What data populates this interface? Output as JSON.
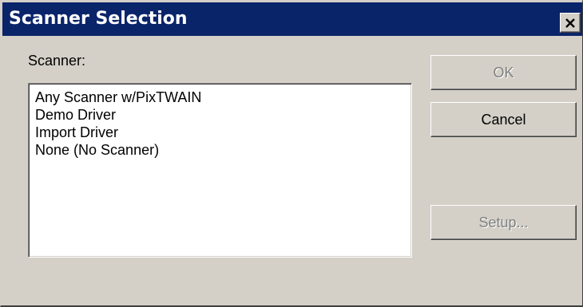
{
  "window": {
    "title": "Scanner Selection",
    "close_icon": "close-icon"
  },
  "scanner": {
    "label": "Scanner:",
    "items": [
      {
        "label": "Any Scanner w/PixTWAIN"
      },
      {
        "label": "Demo Driver"
      },
      {
        "label": "Import Driver"
      },
      {
        "label": "None (No Scanner)"
      }
    ]
  },
  "buttons": {
    "ok": {
      "label": "OK",
      "enabled": false
    },
    "cancel": {
      "label": "Cancel",
      "enabled": true
    },
    "setup": {
      "label": "Setup...",
      "enabled": false
    }
  },
  "colors": {
    "titlebar": "#0a246a",
    "face": "#d4d0c8",
    "disabled_text": "#808080"
  }
}
